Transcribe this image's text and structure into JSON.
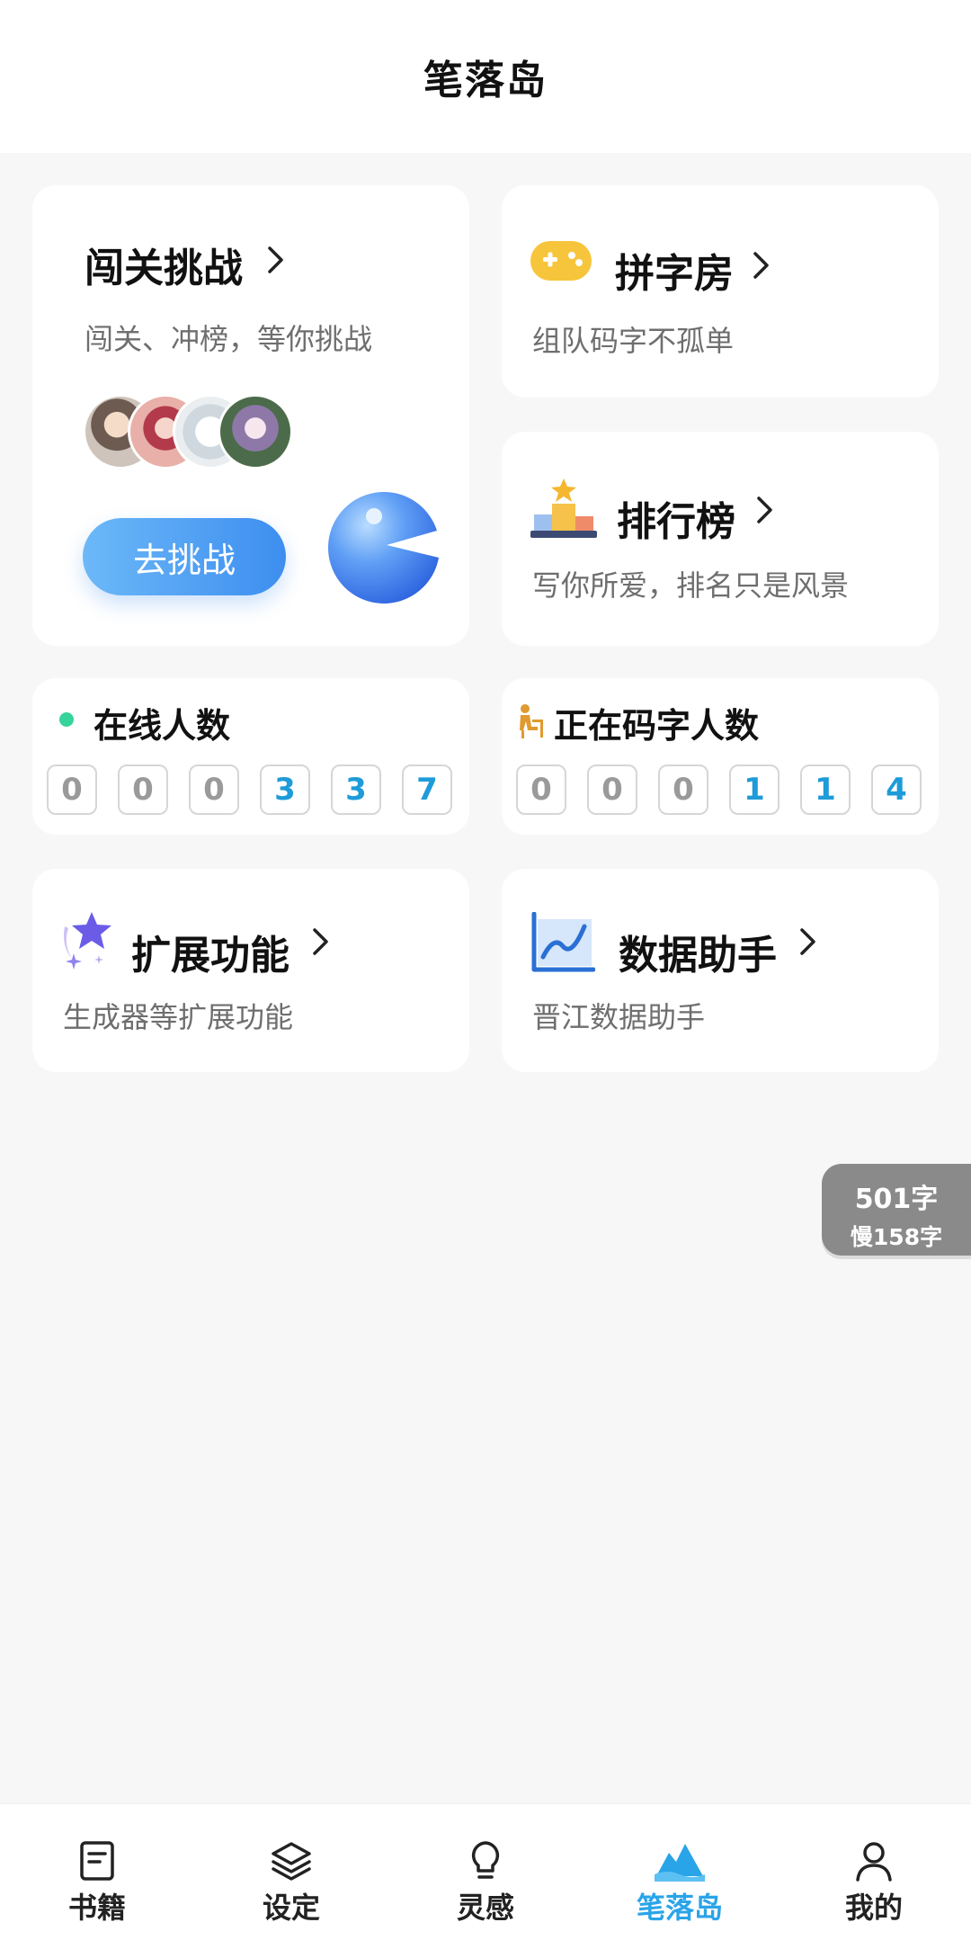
{
  "header": {
    "title": "笔落岛"
  },
  "challenge": {
    "title": "闯关挑战",
    "subtitle": "闯关、冲榜，等你挑战",
    "button_label": "去挑战"
  },
  "pinzi": {
    "title": "拼字房",
    "subtitle": "组队码字不孤单"
  },
  "ranking": {
    "title": "排行榜",
    "subtitle": "写你所爱，排名只是风景"
  },
  "online": {
    "title": "在线人数",
    "digits": [
      "0",
      "0",
      "0",
      "3",
      "3",
      "7"
    ]
  },
  "writing": {
    "title": "正在码字人数",
    "digits": [
      "0",
      "0",
      "0",
      "1",
      "1",
      "4"
    ]
  },
  "extension": {
    "title": "扩展功能",
    "subtitle": "生成器等扩展功能"
  },
  "data_helper": {
    "title": "数据助手",
    "subtitle": "晋江数据助手"
  },
  "float_badge": {
    "count": "501字",
    "slow": "慢158字"
  },
  "tabs": [
    {
      "label": "书籍",
      "icon": "book-icon"
    },
    {
      "label": "设定",
      "icon": "layers-icon"
    },
    {
      "label": "灵感",
      "icon": "lightbulb-icon"
    },
    {
      "label": "笔落岛",
      "icon": "island-icon",
      "active": true
    },
    {
      "label": "我的",
      "icon": "person-icon"
    }
  ],
  "colors": {
    "accent": "#2aa4e8",
    "digit_active": "#1e9bd9",
    "online_dot": "#35d49a",
    "button": "#3d8ef0"
  }
}
